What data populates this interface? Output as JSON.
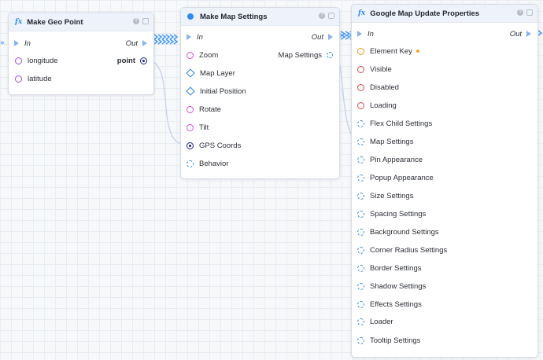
{
  "nodes": {
    "geo": {
      "title": "Make Geo Point",
      "in_label": "In",
      "out_label": "Out",
      "inputs": [
        {
          "label": "longitude",
          "icon": "purple-circle-port"
        },
        {
          "label": "latitude",
          "icon": "purple-circle-port"
        }
      ],
      "output_label": "point"
    },
    "map_settings": {
      "title": "Make Map Settings",
      "in_label": "In",
      "out_label": "Out",
      "output_label": "Map Settings",
      "inputs": [
        {
          "label": "Zoom",
          "icon": "magenta-circle-port"
        },
        {
          "label": "Map Layer",
          "icon": "blue-diamond-port"
        },
        {
          "label": "Initial Position",
          "icon": "blue-diamond-port"
        },
        {
          "label": "Rotate",
          "icon": "magenta-circle-port"
        },
        {
          "label": "Tilt",
          "icon": "magenta-circle-port"
        },
        {
          "label": "GPS Coords",
          "icon": "navy-filled-circle-port"
        },
        {
          "label": "Behavior",
          "icon": "blue-dashed-ring-port"
        }
      ]
    },
    "update": {
      "title": "Google Map Update Properties",
      "in_label": "In",
      "out_label": "Out",
      "inputs": [
        {
          "label": "Element Key",
          "icon": "orange-circle-port"
        },
        {
          "label": "Visible",
          "icon": "red-circle-port"
        },
        {
          "label": "Disabled",
          "icon": "red-circle-port"
        },
        {
          "label": "Loading",
          "icon": "red-circle-port"
        },
        {
          "label": "Flex Child Settings",
          "icon": "blue-dashed-ring-port"
        },
        {
          "label": "Map Settings",
          "icon": "blue-dashed-ring-port"
        },
        {
          "label": "Pin Appearance",
          "icon": "blue-dashed-ring-port"
        },
        {
          "label": "Popup Appearance",
          "icon": "blue-dashed-ring-port"
        },
        {
          "label": "Size Settings",
          "icon": "blue-dashed-ring-port"
        },
        {
          "label": "Spacing Settings",
          "icon": "blue-dashed-ring-port"
        },
        {
          "label": "Background Settings",
          "icon": "blue-dashed-ring-port"
        },
        {
          "label": "Corner Radius Settings",
          "icon": "blue-dashed-ring-port"
        },
        {
          "label": "Border Settings",
          "icon": "blue-dashed-ring-port"
        },
        {
          "label": "Shadow Settings",
          "icon": "blue-dashed-ring-port"
        },
        {
          "label": "Effects Settings",
          "icon": "blue-dashed-ring-port"
        },
        {
          "label": "Loader",
          "icon": "blue-dashed-ring-port"
        },
        {
          "label": "Tooltip Settings",
          "icon": "blue-dashed-ring-port"
        }
      ]
    }
  },
  "colors": {
    "accent": "#2d8cf0",
    "header_bg": "#eef3fb",
    "wire": "#b9c8e6",
    "exec_wire": "#4a9bf2"
  }
}
